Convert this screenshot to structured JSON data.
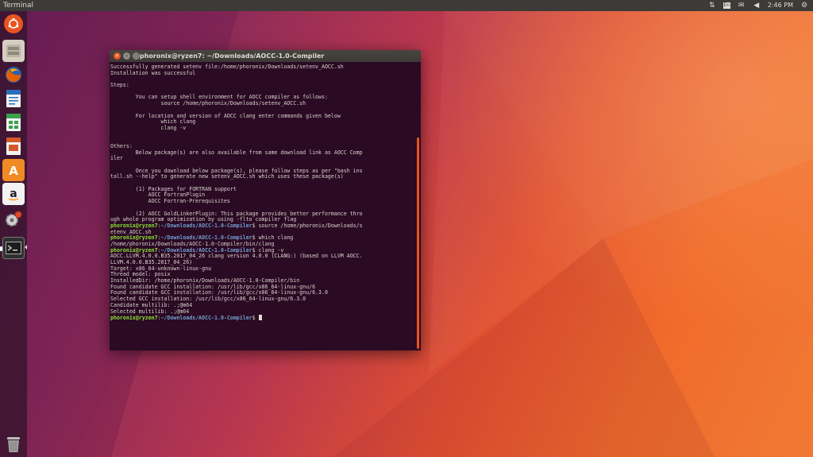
{
  "topbar": {
    "app_title": "Terminal",
    "clock": "2:46 PM",
    "tray_icons": [
      "network-icon",
      "keyboard-layout-icon",
      "mail-icon",
      "volume-icon",
      "power-gear-icon"
    ]
  },
  "launcher": {
    "items": [
      {
        "name": "dash-home",
        "icon": "ubuntu-logo-icon",
        "color": "#e95420"
      },
      {
        "name": "files",
        "icon": "file-cabinet-icon",
        "color": "#c9c2b4"
      },
      {
        "name": "firefox",
        "icon": "firefox-icon",
        "color": "#e66000"
      },
      {
        "name": "writer",
        "icon": "writer-icon",
        "color": "#2a6ebb"
      },
      {
        "name": "calc",
        "icon": "calc-icon",
        "color": "#3aa24b"
      },
      {
        "name": "impress",
        "icon": "impress-icon",
        "color": "#d3582a"
      },
      {
        "name": "software-center",
        "icon": "software-bag-icon",
        "color": "#f08a24"
      },
      {
        "name": "amazon",
        "icon": "amazon-icon",
        "color": "#f5f5f5"
      },
      {
        "name": "system-settings",
        "icon": "settings-gears-icon",
        "color": "#c9c9c9"
      },
      {
        "name": "terminal",
        "icon": "terminal-icon",
        "color": "#3a3a3a",
        "active": true
      }
    ],
    "trash_icon": "trash-icon"
  },
  "terminal": {
    "title": "phoronix@ryzen7: ~/Downloads/AOCC-1.0-Compiler",
    "prompt_user": "phoronix@ryzen7",
    "prompt_path": "~/Downloads/AOCC-1.0-Compiler",
    "lines": [
      {
        "t": "text",
        "v": "Successfully generated setenv file:/home/phoronix/Downloads/setenv_AOCC.sh"
      },
      {
        "t": "text",
        "v": "Installation was successful"
      },
      {
        "t": "text",
        "v": ""
      },
      {
        "t": "text",
        "v": "Steps:"
      },
      {
        "t": "text",
        "v": ""
      },
      {
        "t": "text",
        "v": "        You can setup shell environment for AOCC compiler as follows:"
      },
      {
        "t": "text",
        "v": "                source /home/phoronix/Downloads/setenv_AOCC.sh"
      },
      {
        "t": "text",
        "v": ""
      },
      {
        "t": "text",
        "v": "        For location and version of AOCC clang enter commands given below"
      },
      {
        "t": "text",
        "v": "                which clang"
      },
      {
        "t": "text",
        "v": "                clang -v"
      },
      {
        "t": "text",
        "v": ""
      },
      {
        "t": "text",
        "v": ""
      },
      {
        "t": "text",
        "v": "Others:"
      },
      {
        "t": "text",
        "v": "        Below package(s) are also available from same download link as AOCC Comp"
      },
      {
        "t": "text",
        "v": "iler"
      },
      {
        "t": "text",
        "v": ""
      },
      {
        "t": "text",
        "v": "        Once you download below package(s), please follow steps as per \"bash ins"
      },
      {
        "t": "text",
        "v": "tall.sh --help\" to generate new setenv_AOCC.sh which uses these package(s)"
      },
      {
        "t": "text",
        "v": ""
      },
      {
        "t": "text",
        "v": "        (1) Packages for FORTRAN support"
      },
      {
        "t": "text",
        "v": "            AOCC FortranPlugin"
      },
      {
        "t": "text",
        "v": "            AOCC Fortran-Prerequisites"
      },
      {
        "t": "text",
        "v": ""
      },
      {
        "t": "text",
        "v": "        (2) AOCC GoldLinkerPlugin: This package provides better performance thro"
      },
      {
        "t": "text",
        "v": "ugh whole program optimization by using -flto compiler flag"
      },
      {
        "t": "cmd",
        "v": "source /home/phoronix/Downloads/s"
      },
      {
        "t": "text",
        "v": "etenv_AOCC.sh"
      },
      {
        "t": "cmd",
        "v": "which clang"
      },
      {
        "t": "text",
        "v": "/home/phoronix/Downloads/AOCC-1.0-Compiler/bin/clang"
      },
      {
        "t": "cmd",
        "v": "clang -v"
      },
      {
        "t": "text",
        "v": "AOCC.LLVM.4.0.0.B35.2017_04_26 clang version 4.0.0 (CLANG:) (based on LLVM AOCC."
      },
      {
        "t": "text",
        "v": "LLVM.4.0.0.B35.2017_04_26)"
      },
      {
        "t": "text",
        "v": "Target: x86_64-unknown-linux-gnu"
      },
      {
        "t": "text",
        "v": "Thread model: posix"
      },
      {
        "t": "text",
        "v": "InstalledDir: /home/phoronix/Downloads/AOCC-1.0-Compiler/bin"
      },
      {
        "t": "text",
        "v": "Found candidate GCC installation: /usr/lib/gcc/x86_64-linux-gnu/6"
      },
      {
        "t": "text",
        "v": "Found candidate GCC installation: /usr/lib/gcc/x86_64-linux-gnu/6.3.0"
      },
      {
        "t": "text",
        "v": "Selected GCC installation: /usr/lib/gcc/x86_64-linux-gnu/6.3.0"
      },
      {
        "t": "text",
        "v": "Candidate multilib: .;@m64"
      },
      {
        "t": "text",
        "v": "Selected multilib: .;@m64"
      },
      {
        "t": "cmd",
        "v": "",
        "cursor": true
      }
    ]
  },
  "colors": {
    "prompt_user": "#8ae234",
    "prompt_path": "#729fcf",
    "terminal_bg": "#2b0a24",
    "accent": "#e95420"
  }
}
